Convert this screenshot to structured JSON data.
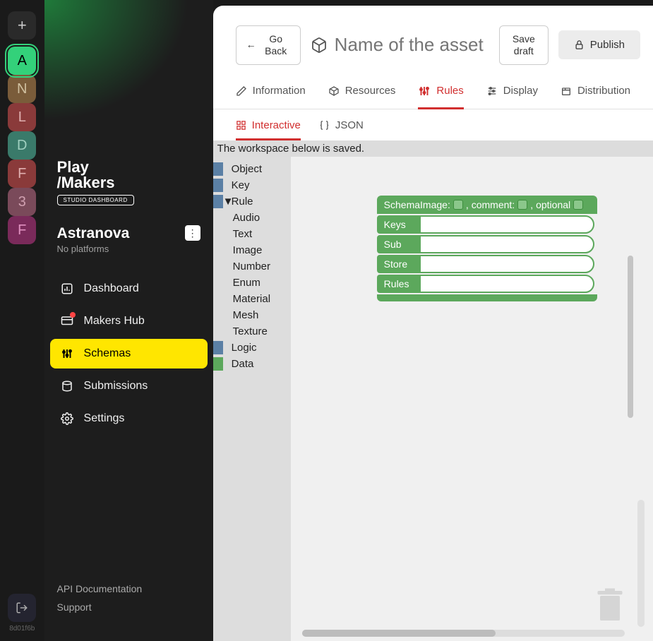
{
  "rail": {
    "items": [
      {
        "letter": "A",
        "bg": "#33d17a",
        "fg": "#000",
        "active": true
      },
      {
        "letter": "N",
        "bg": "#7a5c3a",
        "fg": "#d0c0a0"
      },
      {
        "letter": "L",
        "bg": "#8a3a3a",
        "fg": "#e0b0b0"
      },
      {
        "letter": "D",
        "bg": "#3a7a6a",
        "fg": "#a0d0c0"
      },
      {
        "letter": "F",
        "bg": "#8a3a3a",
        "fg": "#e0b0b0"
      },
      {
        "letter": "3",
        "bg": "#7a4a5a",
        "fg": "#d0a0b0"
      },
      {
        "letter": "F",
        "bg": "#7a2a5a",
        "fg": "#e090c0"
      }
    ],
    "hash": "8d01f6b"
  },
  "brand": {
    "line1": "Play",
    "line2": "/Makers",
    "badge": "STUDIO DASHBOARD"
  },
  "org": {
    "name": "Astranova",
    "sub": "No platforms"
  },
  "nav": [
    {
      "label": "Dashboard",
      "icon": "bar-chart"
    },
    {
      "label": "Makers Hub",
      "icon": "browser",
      "notif": true
    },
    {
      "label": "Schemas",
      "icon": "sliders",
      "active": true
    },
    {
      "label": "Submissions",
      "icon": "package"
    },
    {
      "label": "Settings",
      "icon": "gear"
    }
  ],
  "footer": {
    "api": "API Documentation",
    "support": "Support"
  },
  "header": {
    "goBack": "Go Back",
    "placeholder": "Name of the asset",
    "saveDraft": "Save draft",
    "publish": "Publish"
  },
  "tabs": [
    {
      "label": "Information",
      "icon": "pencil"
    },
    {
      "label": "Resources",
      "icon": "cube"
    },
    {
      "label": "Rules",
      "icon": "sliders",
      "active": true
    },
    {
      "label": "Display",
      "icon": "sliders-h"
    },
    {
      "label": "Distribution",
      "icon": "box"
    }
  ],
  "subtabs": [
    {
      "label": "Interactive",
      "icon": "layout",
      "active": true
    },
    {
      "label": "JSON",
      "icon": "braces"
    }
  ],
  "status": "The workspace below is saved.",
  "toolbox": {
    "categories": [
      {
        "label": "Object",
        "color": "blue"
      },
      {
        "label": "Key",
        "color": "blue"
      },
      {
        "label": "Rule",
        "color": "blue",
        "expanded": true,
        "children": [
          "Audio",
          "Text",
          "Image",
          "Number",
          "Enum",
          "Material",
          "Mesh",
          "Texture"
        ]
      },
      {
        "label": "Logic",
        "color": "blue"
      },
      {
        "label": "Data",
        "color": "green"
      }
    ]
  },
  "block": {
    "title": "SchemaImage:",
    "sep": " , ",
    "fields": [
      "comment:",
      "optional"
    ],
    "rows": [
      "Keys",
      "Sub",
      "Store",
      "Rules"
    ]
  }
}
